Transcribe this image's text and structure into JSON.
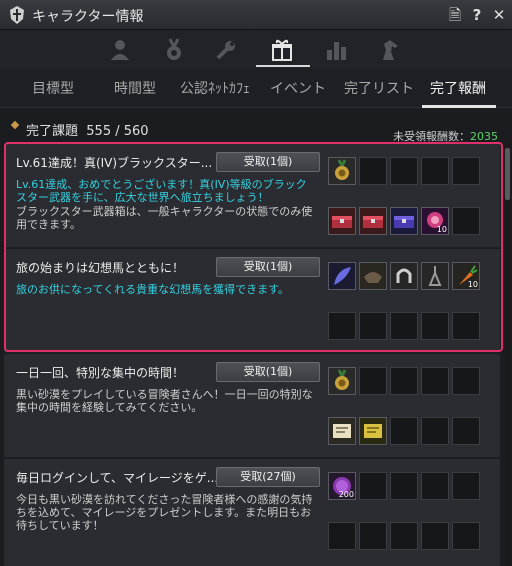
{
  "window": {
    "title": "キャラクター情報",
    "buttons": {
      "note": "🗎",
      "help": "?",
      "close": "✕"
    }
  },
  "categories": [
    {
      "icon": "person-icon"
    },
    {
      "icon": "medal-icon"
    },
    {
      "icon": "wrench-icon"
    },
    {
      "icon": "gift-icon",
      "active": true
    },
    {
      "icon": "bar-chart-icon"
    },
    {
      "icon": "horse-icon"
    }
  ],
  "tabs": [
    {
      "label": "目標型"
    },
    {
      "label": "時間型"
    },
    {
      "label": "公認ﾈｯﾄｶﾌｪ"
    },
    {
      "label": "イベント"
    },
    {
      "label": "完了リスト"
    },
    {
      "label": "完了報酬",
      "active": true
    }
  ],
  "summary": {
    "label": "完了課題",
    "completed": "555 / 560",
    "unclaimed_label": "未受領報酬数：",
    "unclaimed_value": "2035"
  },
  "colors": {
    "accent_cyan": "#33d1e0",
    "highlight": "#e0306a",
    "count_green": "#5fd066"
  },
  "tasks": [
    {
      "title": "Lv.61達成！真(IV)ブラックスター...",
      "button": "受取(1個)",
      "desc": "Lv.61達成、おめでとうございます！真(IV)等級のブラックスター武器を手に、広大な世界へ旅立ちましょう！",
      "desc2": "ブラックスター武器箱は、一般キャラクターの状態でのみ使用できます。",
      "row1_items": [
        {
          "name": "medal-item"
        }
      ],
      "row2_items": [
        {
          "name": "red-chest-item"
        },
        {
          "name": "red-chest-item"
        },
        {
          "name": "blue-chest-item"
        },
        {
          "name": "purple-orb-item",
          "count": "10"
        }
      ]
    },
    {
      "title": "旅の始まりは幻想馬とともに！",
      "button": "受取(1個)",
      "desc": "旅のお供になってくれる貴重な幻想馬を獲得できます。",
      "row1_items": [
        {
          "name": "blue-feather-item"
        },
        {
          "name": "saddle-item"
        },
        {
          "name": "horseshoe-item"
        },
        {
          "name": "stirrup-item"
        },
        {
          "name": "carrot-item",
          "count": "10"
        }
      ],
      "row2_items": []
    },
    {
      "title": "一日一回、特別な集中の時間！",
      "button": "受取(1個)",
      "desc": "黒い砂漠をプレイしている冒険者さんへ！一日一回の特別な集中の時間を経験してみてください。",
      "row1_items": [
        {
          "name": "medal-item"
        }
      ],
      "row2_items": [
        {
          "name": "scroll-item"
        },
        {
          "name": "gold-scroll-item"
        }
      ]
    },
    {
      "title": "毎日ログインして、マイレージをゲ...",
      "button": "受取(27個)",
      "desc": "今日も黒い砂漠を訪れてくださった冒険者様への感謝の気持ちを込めて、マイレージをプレゼントします。また明日もお待ちしています！",
      "row1_items": [
        {
          "name": "mileage-coin-item",
          "count": "200"
        }
      ],
      "row2_items": []
    }
  ]
}
